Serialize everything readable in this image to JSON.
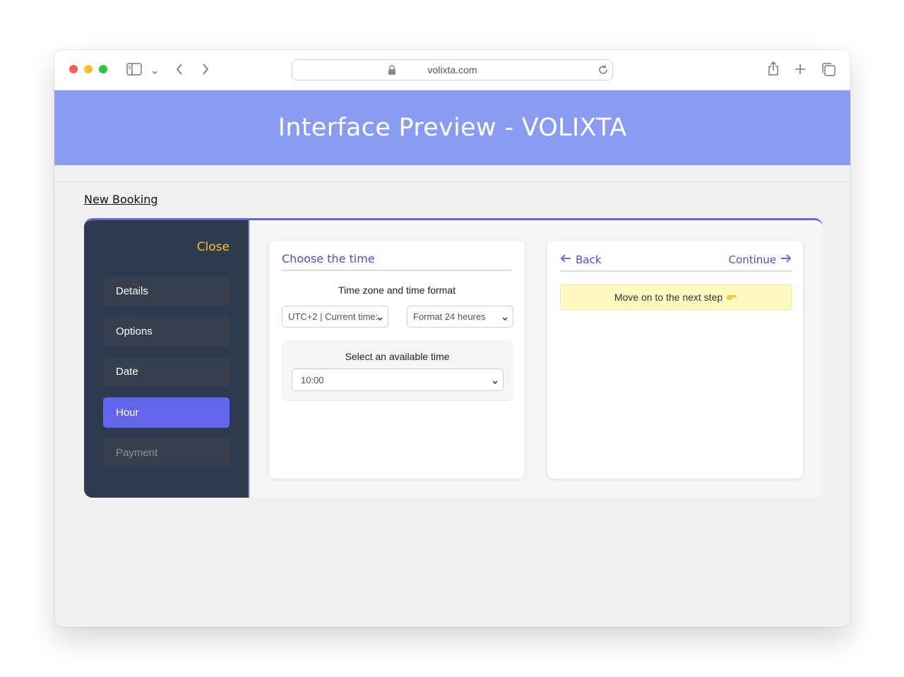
{
  "browser": {
    "url": "volixta.com"
  },
  "banner": {
    "title": "Interface Preview - VOLIXTA"
  },
  "breadcrumb": {
    "label": "New Booking"
  },
  "sidebar": {
    "close_label": "Close",
    "items": [
      {
        "label": "Details",
        "state": "default"
      },
      {
        "label": "Options",
        "state": "default"
      },
      {
        "label": "Date",
        "state": "default"
      },
      {
        "label": "Hour",
        "state": "active"
      },
      {
        "label": "Payment",
        "state": "disabled"
      }
    ]
  },
  "time_card": {
    "title": "Choose the time",
    "timezone_label": "Time zone and time format",
    "timezone_value": "UTC+2 | Current time:",
    "format_value": "Format 24 heures",
    "available_label": "Select an available time",
    "time_value": "10:00"
  },
  "action_card": {
    "back_label": "Back",
    "continue_label": "Continue",
    "notice": "Move on to the next step",
    "notice_icon": "pointing-hand-icon"
  },
  "colors": {
    "banner": "#8a9cf2",
    "sidebar": "#2e3a4d",
    "accent": "#6366ec",
    "close": "#f6c323",
    "notice_bg": "#fefac0"
  }
}
